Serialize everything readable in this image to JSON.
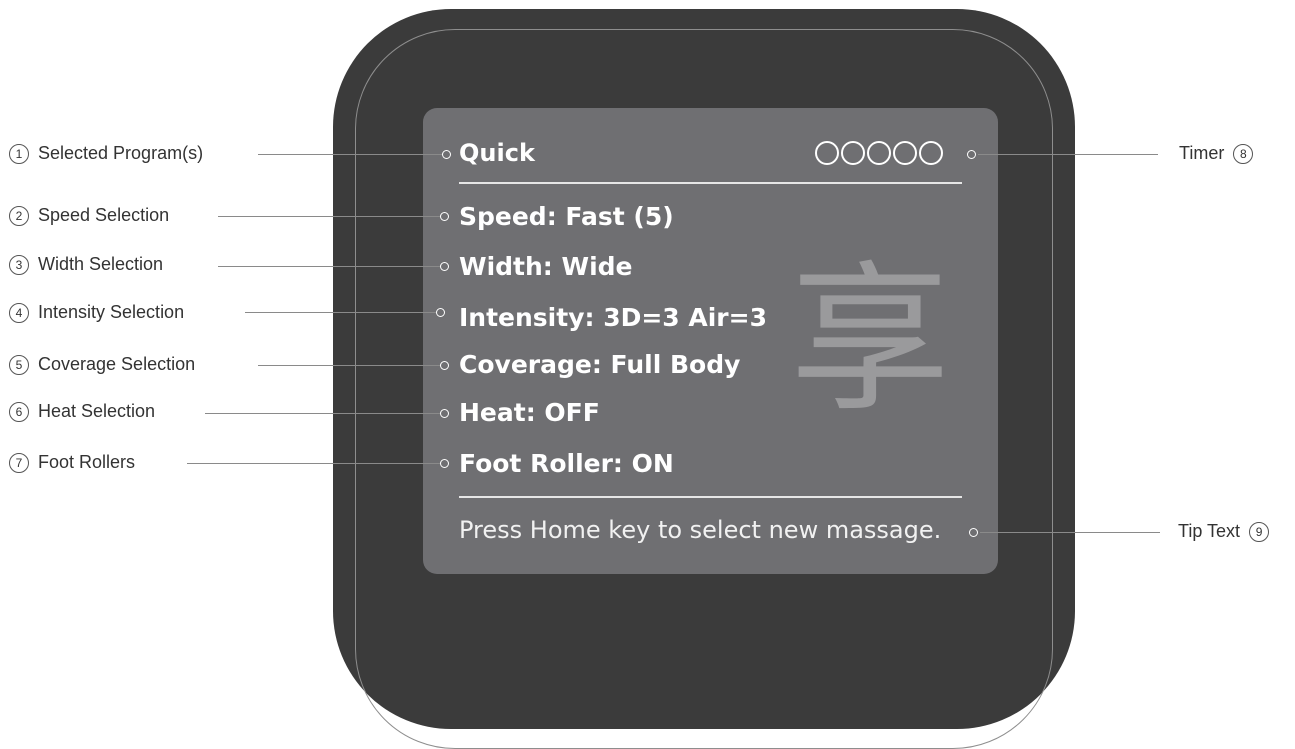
{
  "screen": {
    "program": "Quick",
    "lines": [
      "Speed: Fast (5)",
      "Width: Wide",
      "Intensity: 3D=3  Air=3",
      "Coverage: Full Body",
      "Heat: OFF",
      "Foot Roller: ON"
    ],
    "tip": "Press Home key to select new massage.",
    "glyph": "享",
    "timer_circles": 5
  },
  "callouts": [
    {
      "num": "1",
      "label": "Selected Program(s)"
    },
    {
      "num": "2",
      "label": "Speed Selection"
    },
    {
      "num": "3",
      "label": "Width Selection"
    },
    {
      "num": "4",
      "label": "Intensity Selection"
    },
    {
      "num": "5",
      "label": "Coverage Selection"
    },
    {
      "num": "6",
      "label": "Heat Selection"
    },
    {
      "num": "7",
      "label": "Foot Rollers"
    },
    {
      "num": "8",
      "label": "Timer"
    },
    {
      "num": "9",
      "label": "Tip Text"
    }
  ],
  "colors": {
    "remote_body": "#3b3b3b",
    "screen": "#6f6f72",
    "leader_line": "#8a8a8a"
  }
}
